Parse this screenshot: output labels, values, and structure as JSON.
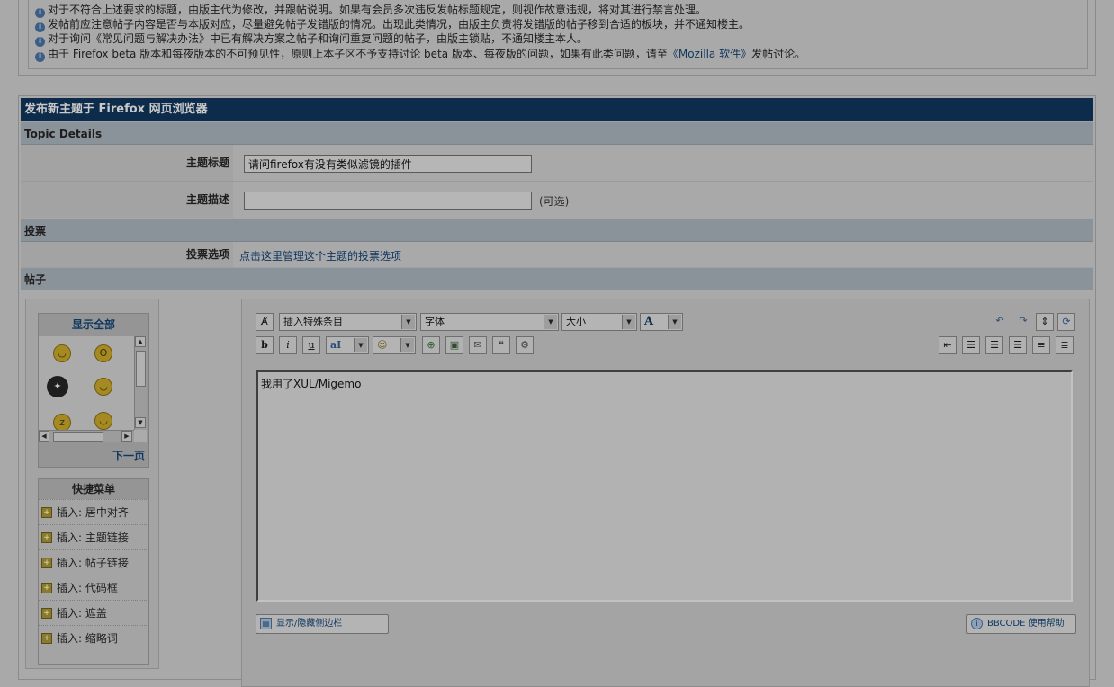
{
  "rules": {
    "lines": [
      "对于不符合上述要求的标题，由版主代为修改，并跟帖说明。如果有会员多次违反发帖标题规定，则视作故意违规，将对其进行禁言处理。",
      "发帖前应注意帖子内容是否与本版对应，尽量避免帖子发错版的情况。出现此类情况，由版主负责将发错版的帖子移到合适的板块，并不通知楼主。",
      "对于询问《常见问题与解决办法》中已有解决方案之帖子和询问重复问题的帖子，由版主锁贴，不通知楼主本人。",
      "由于 Firefox beta 版本和每夜版本的不可预见性，原则上本子区不予支持讨论 beta 版本、每夜版的问题，如果有此类问题，请至"
    ],
    "link_text": "《Mozilla 软件》",
    "link_suffix": "发帖讨论。",
    "info_icon": "info-icon"
  },
  "form": {
    "title": "发布新主题于 Firefox 网页浏览器",
    "topic_details_heading": "Topic Details",
    "subject_label": "主题标题",
    "subject_value": "请问firefox有没有类似滤镜的插件",
    "description_label": "主题描述",
    "description_value": "",
    "optional_hint": "(可选)",
    "poll_heading": "投票",
    "poll_label": "投票选项",
    "poll_link": "点击这里管理这个主题的投票选项",
    "post_heading": "帖子"
  },
  "emoticons": {
    "title": "显示全部",
    "next_page": "下一页",
    "icons": [
      "smile-emoticon",
      "glasses-emoticon",
      "ninja-emoticon",
      "happy-emoticon",
      "sleepy-emoticon",
      "grin-emoticon"
    ]
  },
  "quick_menu": {
    "title": "快捷菜单",
    "items": [
      "插入: 居中对齐",
      "插入: 主题链接",
      "插入: 帖子链接",
      "插入: 代码框",
      "插入: 遮盖",
      "插入: 缩略词"
    ]
  },
  "editor": {
    "special_item_select": "插入特殊条目",
    "font_select": "字体",
    "size_select": "大小",
    "font_color_label": "A",
    "content": "我用了XUL/Migemo",
    "toggle_sidebar_label": "显示/隐藏侧边栏",
    "bbcode_help_label": "BBCODE 使用帮助",
    "format_buttons": [
      "b",
      "i",
      "u"
    ],
    "colors": {
      "title_bar": "#0d2c4c",
      "section_bar": "#8a929a",
      "link": "#0f3761"
    }
  }
}
